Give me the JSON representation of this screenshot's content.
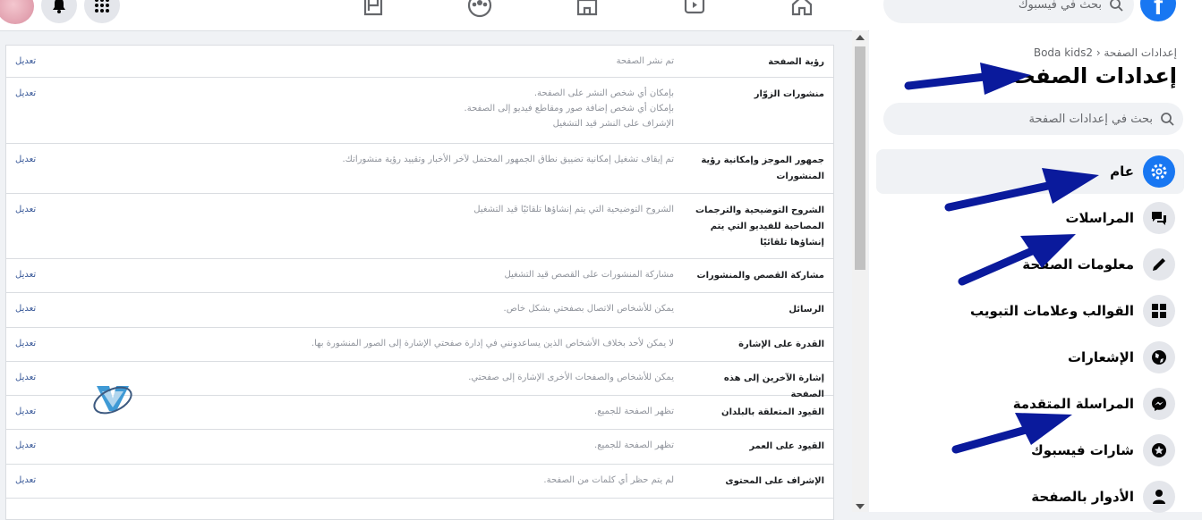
{
  "topbar": {
    "search_placeholder": "بحث في فيسبوك",
    "logo_letter": "f"
  },
  "sidebar": {
    "breadcrumb": "إعدادات الصفحة ‹ Boda kids2",
    "title": "إعدادات الصفحة",
    "search_placeholder": "بحث في إعدادات الصفحة",
    "items": [
      {
        "label": "عام",
        "icon": "gear-icon",
        "active": true
      },
      {
        "label": "المراسلات",
        "icon": "chat-bubbles-icon"
      },
      {
        "label": "معلومات الصفحة",
        "icon": "pencil-icon"
      },
      {
        "label": "القوالب وعلامات التبويب",
        "icon": "grid-icon"
      },
      {
        "label": "الإشعارات",
        "icon": "globe-icon"
      },
      {
        "label": "المراسلة المتقدمة",
        "icon": "messenger-icon"
      },
      {
        "label": "شارات فيسبوك",
        "icon": "badge-star-icon"
      },
      {
        "label": "الأدوار بالصفحة",
        "icon": "person-icon"
      }
    ]
  },
  "settings": {
    "edit_label": "تعديل",
    "rows": [
      {
        "label": "رؤية الصفحة",
        "lines": [
          "تم نشر الصفحة"
        ]
      },
      {
        "label": "منشورات الزوّار",
        "lines": [
          "بإمكان أي شخص النشر على الصفحة.",
          "بإمكان أي شخص إضافة صور ومقاطع فيديو إلى الصفحة.",
          "الإشراف على النشر قيد التشغيل"
        ]
      },
      {
        "label": "جمهور الموجز وإمكانية رؤية المنشورات",
        "lines": [
          "تم إيقاف تشغيل إمكانية تضييق نطاق الجمهور المحتمل لآخر الأخبار وتقييد رؤية منشوراتك."
        ]
      },
      {
        "label": "الشروح التوضيحية والترجمات المصاحبة للفيديو التي يتم إنشاؤها تلقائيًا",
        "lines": [
          "الشروح التوضيحية التي يتم إنشاؤها تلقائيًا قيد التشغيل"
        ]
      },
      {
        "label": "مشاركة القصص والمنشورات",
        "lines": [
          "مشاركة المنشورات على القصص قيد التشغيل"
        ]
      },
      {
        "label": "الرسائل",
        "lines": [
          "يمكن للأشخاص الاتصال بصفحتي بشكل خاص."
        ]
      },
      {
        "label": "القدرة على الإشارة",
        "lines": [
          "لا يمكن لأحد بخلاف الأشخاص الذين يساعدونني في إدارة صفحتي الإشارة إلى الصور المنشورة بها."
        ]
      },
      {
        "label": "إشارة الآخرين إلى هذه الصفحة",
        "lines": [
          "يمكن للأشخاص والصفحات الأخرى الإشارة إلى صفحتي."
        ]
      },
      {
        "label": "القيود المتعلقة بالبلدان",
        "lines": [
          "تظهر الصفحة للجميع."
        ]
      },
      {
        "label": "القيود على العمر",
        "lines": [
          "تظهر الصفحة للجميع."
        ]
      },
      {
        "label": "الإشراف على المحتوى",
        "lines": [
          "لم يتم حظر أي كلمات من الصفحة."
        ]
      }
    ]
  },
  "colors": {
    "accent": "#1877f2",
    "annotation_arrow": "#0a1a9c",
    "link": "#385898"
  }
}
